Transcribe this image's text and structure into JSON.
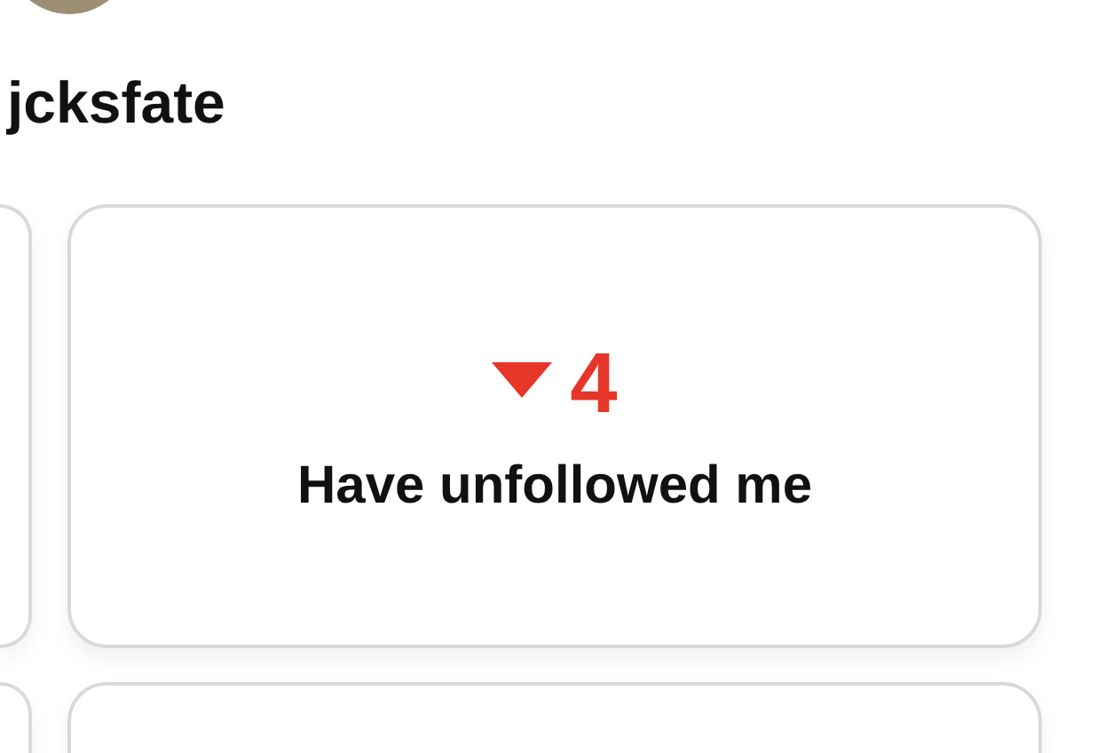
{
  "profile": {
    "username": "jcksfate"
  },
  "stats": [
    {
      "value": "4",
      "down": true,
      "label": "Have unfollowed me"
    }
  ]
}
